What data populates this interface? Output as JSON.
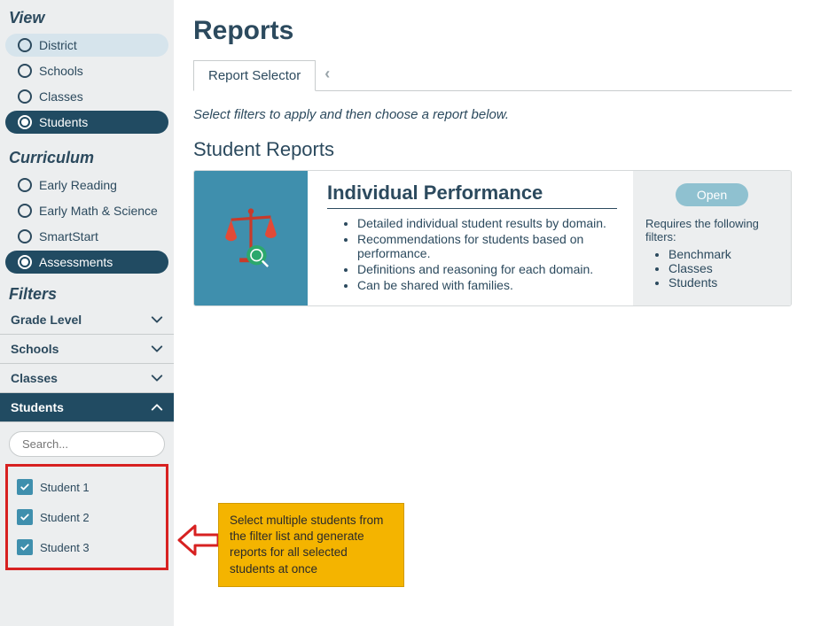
{
  "sidebar": {
    "view_heading": "View",
    "view_items": [
      {
        "label": "District"
      },
      {
        "label": "Schools"
      },
      {
        "label": "Classes"
      },
      {
        "label": "Students"
      }
    ],
    "curriculum_heading": "Curriculum",
    "curriculum_items": [
      {
        "label": "Early Reading"
      },
      {
        "label": "Early Math & Science"
      },
      {
        "label": "SmartStart"
      },
      {
        "label": "Assessments"
      }
    ],
    "filters_heading": "Filters",
    "filter_rows": [
      {
        "label": "Grade Level"
      },
      {
        "label": "Schools"
      },
      {
        "label": "Classes"
      },
      {
        "label": "Students"
      }
    ],
    "search_placeholder": "Search...",
    "students_list": [
      {
        "label": "Student 1"
      },
      {
        "label": "Student 2"
      },
      {
        "label": "Student 3"
      }
    ]
  },
  "main": {
    "title": "Reports",
    "tab_label": "Report Selector",
    "instruction": "Select filters to apply and then choose a report below.",
    "section_title": "Student Reports",
    "card": {
      "title": "Individual Performance",
      "bullets": [
        "Detailed individual student results by domain.",
        "Recommendations for students based on performance.",
        "Definitions and reasoning for each domain.",
        "Can be shared with families."
      ],
      "open_label": "Open",
      "requires_label": "Requires the following filters:",
      "req_items": [
        "Benchmark",
        "Classes",
        "Students"
      ]
    }
  },
  "annotation": {
    "text": "Select multiple students from the filter list and generate reports for all selected students at once"
  }
}
